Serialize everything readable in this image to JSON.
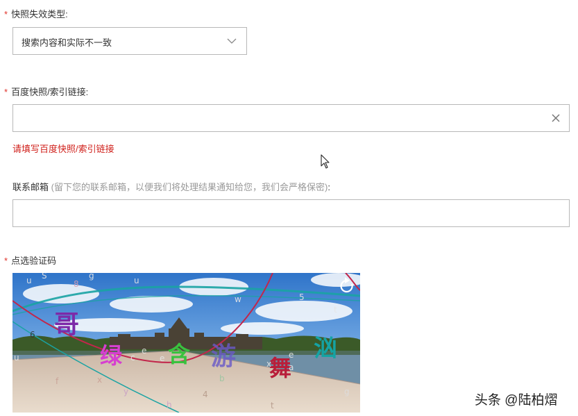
{
  "form": {
    "required_mark": "*",
    "snapshot_type": {
      "label": "快照失效类型:",
      "selected": "搜索内容和实际不一致"
    },
    "snapshot_link": {
      "label": "百度快照/索引链接:",
      "value": "",
      "error": "请填写百度快照/索引链接"
    },
    "email": {
      "label": "联系邮箱",
      "hint": "(留下您的联系邮箱，以便我们将处理结果通知给您，我们会严格保密)",
      "colon": ":",
      "value": ""
    },
    "captcha": {
      "label": "点选验证码",
      "chars": [
        "哥",
        "绿",
        "含",
        "游",
        "舞",
        "汹"
      ],
      "noise": [
        "u",
        "S",
        "8",
        "g",
        "u",
        "w",
        "5",
        "t",
        "6",
        "u",
        "e",
        "c",
        "e",
        "x",
        "e",
        "a",
        "f",
        "x",
        "y",
        "h",
        "4",
        "t",
        "g",
        "b"
      ]
    }
  },
  "watermark": "头条 @陆柏熠",
  "colors": {
    "required": "#e0332b",
    "error": "#d0211c",
    "border": "#b8b8b8",
    "hint": "#999999"
  }
}
